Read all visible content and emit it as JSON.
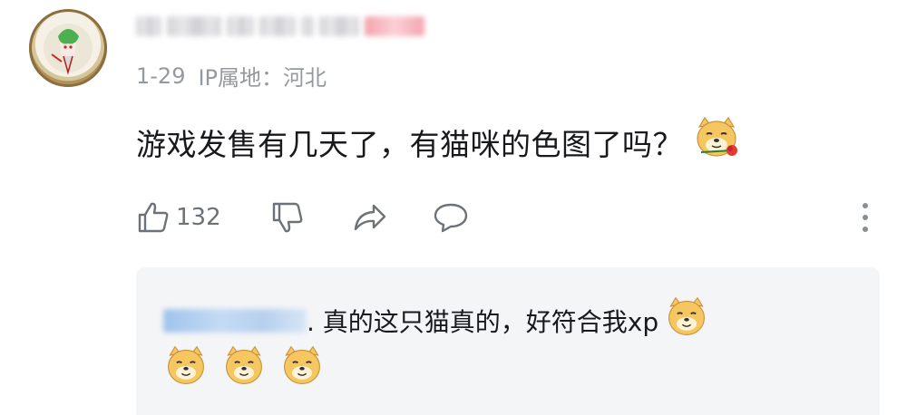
{
  "comment": {
    "avatar_icon": "anime-character-avatar",
    "username_label": "",
    "date": "1-29",
    "ip_location": "IP属地：河北",
    "text": "游戏发售有几天了，有猫咪的色图了吗？",
    "text_emoji": "doge-rose-emoji",
    "like_count": "132",
    "icons": {
      "like": "thumbs-up-icon",
      "dislike": "thumbs-down-icon",
      "share": "share-arrow-icon",
      "reply": "comment-bubble-icon",
      "more": "more-vertical-icon"
    }
  },
  "reply": {
    "text": ". 真的这只猫真的，好符合我xp",
    "line1_emoji": "doge-emoji",
    "trailing_emojis": [
      "doge-emoji",
      "doge-emoji",
      "doge-emoji"
    ]
  },
  "colors": {
    "text_primary": "#18191c",
    "text_secondary": "#9499a0",
    "icon_gray": "#6d7278",
    "reply_bg": "#f4f5f7",
    "doge_fill": "#f6c661"
  }
}
